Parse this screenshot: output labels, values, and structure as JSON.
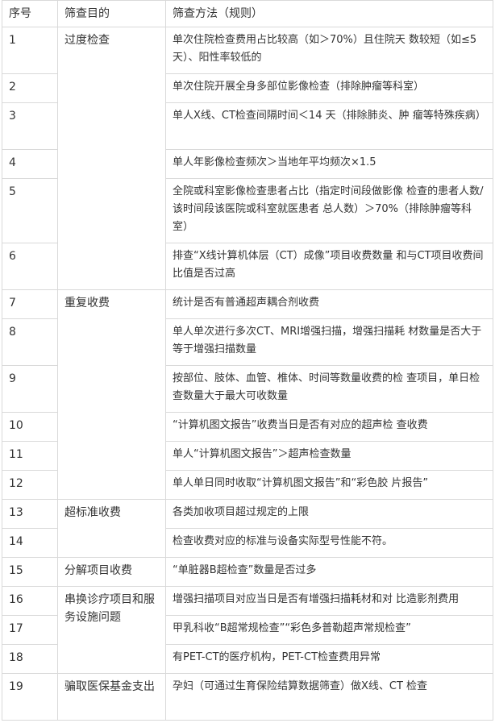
{
  "headers": [
    "序号",
    "筛查目的",
    "筛查方法（规则）"
  ],
  "groups": [
    {
      "purpose": "过度检查",
      "rows": [
        {
          "no": "1",
          "method": "单次住院检查费用占比较高（如＞70%）且住院天 数较短（如≤5 天）、阳性率较低的"
        },
        {
          "no": "2",
          "method": "单次住院开展全身多部位影像检查（排除肿瘤等科室）"
        },
        {
          "no": "3",
          "method": "单人X线、CT检查间隔时间＜14 天（排除肺炎、肿 瘤等特殊疾病）"
        },
        {
          "no": "4",
          "method": "单人年影像检查频次＞当地年平均频次×1.5"
        },
        {
          "no": "5",
          "method": "全院或科室影像检查患者占比（指定时间段做影像 检查的患者人数/该时间段该医院或科室就医患者 总人数）＞70%（排除肿瘤等科室）"
        },
        {
          "no": "6",
          "method": "排查“X线计算机体层（CT）成像”项目收费数量 和与CT项目收费间比值是否过高"
        }
      ]
    },
    {
      "purpose": "重复收费",
      "rows": [
        {
          "no": "7",
          "method": "统计是否有普通超声耦合剂收费"
        },
        {
          "no": "8",
          "method": "单人单次进行多次CT、MRI增强扫描，增强扫描耗 材数量是否大于等于增强扫描数量"
        },
        {
          "no": "9",
          "method": "按部位、肢体、血管、椎体、时间等数量收费的检 查项目，单日检查数量大于最大可收数量"
        },
        {
          "no": "10",
          "method": "“计算机图文报告”收费当日是否有对应的超声检 查收费"
        },
        {
          "no": "11",
          "method": "单人“计算机图文报告”＞超声检查数量"
        },
        {
          "no": "12",
          "method": "单人单日同时收取“计算机图文报告”和“彩色胶 片报告”"
        }
      ]
    },
    {
      "purpose": "超标准收费",
      "rows": [
        {
          "no": "13",
          "method": "各类加收项目超过规定的上限"
        },
        {
          "no": "14",
          "method": "检查收费对应的标准与设备实际型号性能不符。"
        }
      ]
    },
    {
      "purpose": "分解项目收费",
      "rows": [
        {
          "no": "15",
          "method": "“单脏器B超检查”数量是否过多"
        }
      ]
    },
    {
      "purpose": "串换诊疗项目和服务设施问题",
      "rows": [
        {
          "no": "16",
          "method": "增强扫描项目对应当日是否有增强扫描耗材和对 比造影剂费用"
        },
        {
          "no": "17",
          "method": "甲乳科收“B超常规检查”“彩色多普勒超声常规检查”"
        },
        {
          "no": "18",
          "method": "有PET-CT的医疗机构，PET-CT检查费用异常"
        }
      ]
    },
    {
      "purpose": "骗取医保基金支出",
      "rows": [
        {
          "no": "19",
          "method": "孕妇（可通过生育保险结算数据筛查）做X线、CT 检查"
        }
      ]
    }
  ]
}
